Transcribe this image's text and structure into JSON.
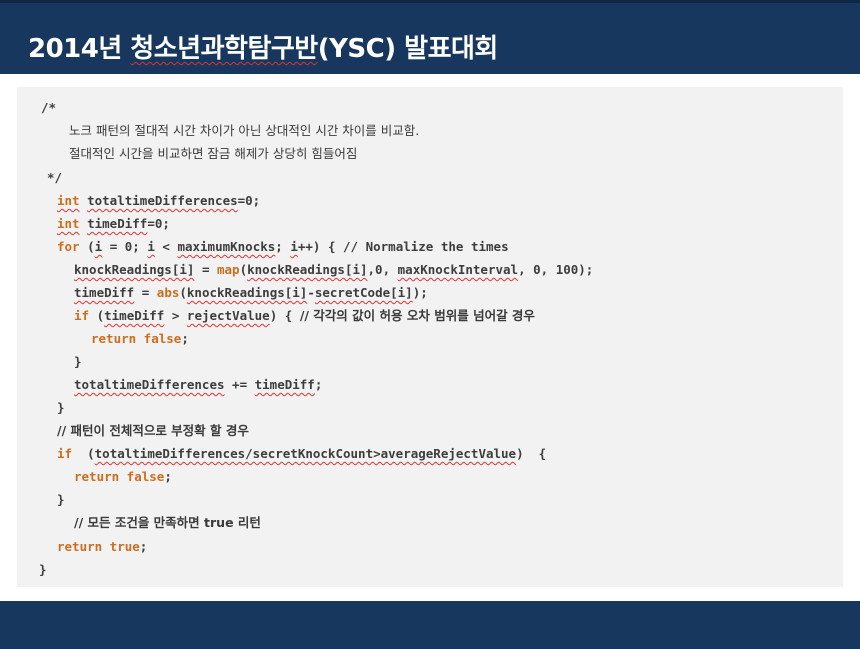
{
  "header": {
    "title_prefix": "2014년 ",
    "title_underlined": "청소년과학탐구반",
    "title_suffix": "(YSC) 발표대회"
  },
  "code": {
    "comment_open": "/*",
    "comment_line1": "노크 패턴의 절대적 시간 차이가 아닌 상대적인 시간 차이를 비교함.",
    "comment_line2": "절대적인 시간을 비교하면 잠금 해제가 상당히 힘들어짐",
    "comment_close": "*/",
    "l1_kw": "int",
    "l1_var": "totaltimeDifferences",
    "l1_rest": "=0;",
    "l2_kw": "int",
    "l2_var": "timeDiff",
    "l2_rest": "=0;",
    "l3_kw": "for",
    "l3_a": " (",
    "l3_i1": "i",
    "l3_b": " = 0; ",
    "l3_i2": "i",
    "l3_c": " < ",
    "l3_max": "maximumKnocks",
    "l3_d": "; ",
    "l3_i3": "i",
    "l3_e": "++) { // Normalize the times",
    "l4_var": "knockReadings[i]",
    "l4_a": " = ",
    "l4_fn": "map",
    "l4_b": "(",
    "l4_var2": "knockReadings[i]",
    "l4_c": ",0, ",
    "l4_var3": "maxKnockInterval",
    "l4_d": ", 0, 100);",
    "l5_var": "timeDiff",
    "l5_a": " = ",
    "l5_fn": "abs",
    "l5_b": "(",
    "l5_var2": "knockReadings[i]",
    "l5_c": "-",
    "l5_var3": "secretCode[i]",
    "l5_d": ");",
    "l6_kw": "if",
    "l6_a": " (",
    "l6_var": "timeDiff",
    "l6_b": " > ",
    "l6_var2": "rejectValue",
    "l6_c": ") { ",
    "l6_comment": "// 각각의 값이 허용 오차 범위를 넘어갈 경우",
    "l7_kw": "return false",
    "l7_rest": ";",
    "l8": "}",
    "l9_var": "totaltimeDifferences",
    "l9_a": " += ",
    "l9_var2": "timeDiff",
    "l9_b": ";",
    "l10": "}",
    "l11_comment": "// 패턴이 전체적으로 부정확 할 경우",
    "l12_kw": "if",
    "l12_a": "  (",
    "l12_var": "totaltimeDifferences/secretKnockCount>averageRejectValue",
    "l12_b": ")  {",
    "l13_kw": "return false",
    "l13_rest": ";",
    "l14": "}",
    "l15_comment": "// 모든 조건을 만족하면 true 리턴",
    "l16_kw": "return true",
    "l16_rest": ";",
    "l17": "}"
  }
}
